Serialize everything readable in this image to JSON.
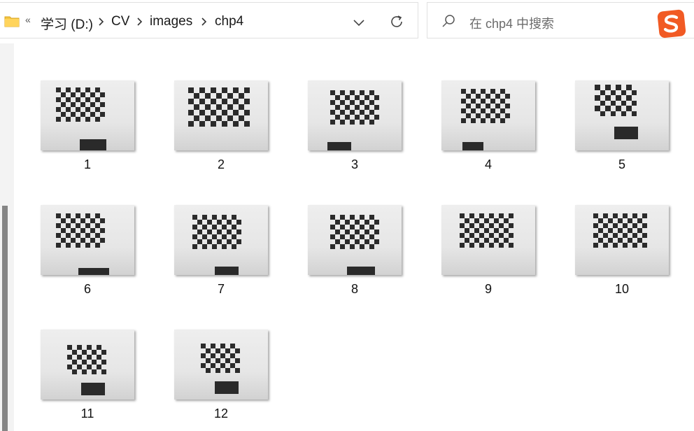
{
  "address_bar": {
    "overflow_chevron": "«",
    "breadcrumbs": [
      {
        "label": "学习 (D:)"
      },
      {
        "label": "CV"
      },
      {
        "label": "images"
      },
      {
        "label": "chp4"
      }
    ]
  },
  "search": {
    "placeholder": "在 chp4 中搜索"
  },
  "files": [
    {
      "name": "1"
    },
    {
      "name": "2"
    },
    {
      "name": "3"
    },
    {
      "name": "4"
    },
    {
      "name": "5"
    },
    {
      "name": "6"
    },
    {
      "name": "7"
    },
    {
      "name": "8"
    },
    {
      "name": "9"
    },
    {
      "name": "10"
    },
    {
      "name": "11"
    },
    {
      "name": "12"
    }
  ],
  "colors": {
    "folder": "#f4c542",
    "sogou_brand": "#f15a24",
    "scrollbar": "#858585"
  }
}
